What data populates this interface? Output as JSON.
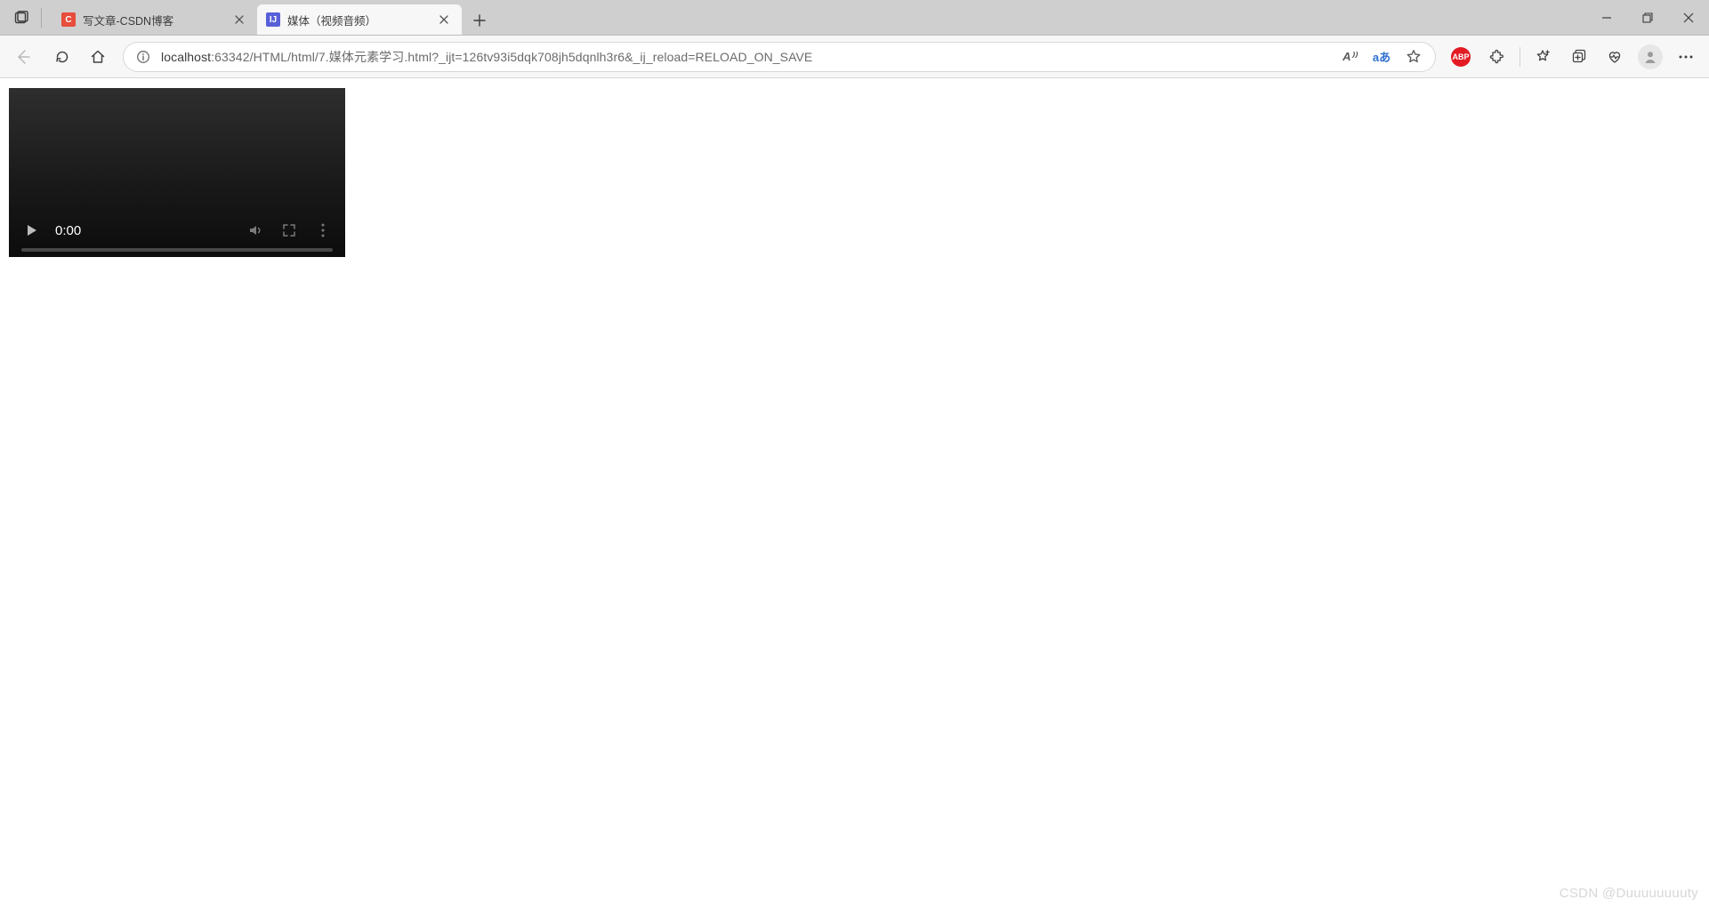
{
  "browser": {
    "tabs": [
      {
        "title": "写文章-CSDN博客",
        "favicon_label": "C",
        "active": false
      },
      {
        "title": "媒体（视频音频）",
        "favicon_label": "IJ",
        "active": true
      }
    ],
    "url_host": "localhost",
    "url_rest": ":63342/HTML/html/7.媒体元素学习.html?_ijt=126tv93i5dqk708jh5dqnlh3r6&_ij_reload=RELOAD_ON_SAVE",
    "read_aloud_label": "A⁾⁾",
    "translate_label": "aあ",
    "abp_label": "ABP"
  },
  "video": {
    "time": "0:00"
  },
  "watermark": "CSDN @Duuuuuuuuty"
}
